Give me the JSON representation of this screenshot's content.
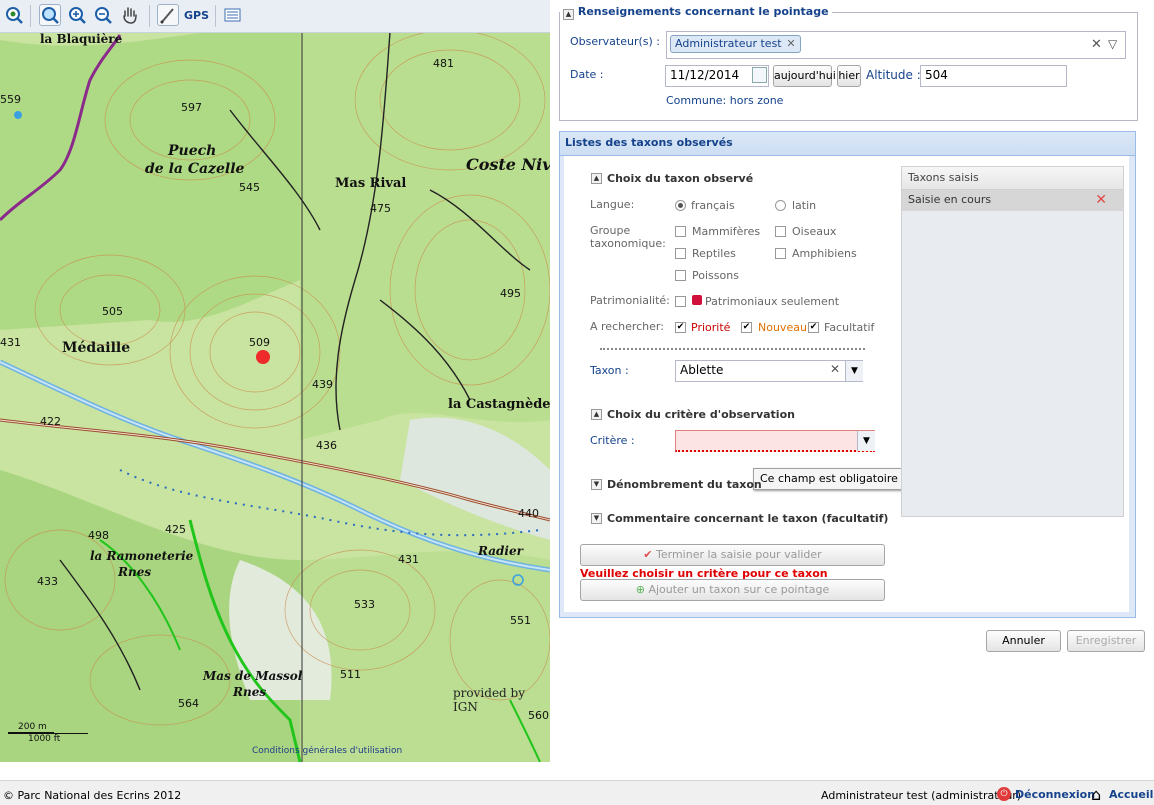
{
  "map": {
    "toolbar": {
      "gps_label": "GPS"
    },
    "labels": {
      "puech": "Puech",
      "cazelle": "de la Cazelle",
      "mas_rival": "Mas Rival",
      "coste": "Coste Niv",
      "medaille": "Médaille",
      "castagnede": "la Castagnède",
      "ramoneterie": "la Ramoneterie",
      "rnes1": "Rnes",
      "massol": "Mas de Massol",
      "rnes2": "Rnes",
      "radier": "Radier",
      "blaquiere": "la Blaquière"
    },
    "elevations": [
      "597",
      "545",
      "475",
      "481",
      "495",
      "505",
      "509",
      "439",
      "436",
      "422",
      "431",
      "498",
      "425",
      "433",
      "431",
      "533",
      "440",
      "511",
      "564",
      "551",
      "560",
      "559"
    ],
    "scale": {
      "meters": "200 m",
      "feet": "1000 ft"
    },
    "credit": "provided by IGN",
    "conditions": "Conditions générales d'utilisation"
  },
  "pointage": {
    "legend": "Renseignements concernant le pointage",
    "observers_label": "Observateur(s) :",
    "observer_tag": "Administrateur test",
    "date_label": "Date :",
    "date_value": "11/12/2014",
    "today_button": "aujourd'hui",
    "yesterday_button": "hier",
    "altitude_label": "Altitude :",
    "altitude_value": "504",
    "commune": "Commune: hors zone"
  },
  "taxons": {
    "header": "Listes des taxons observés",
    "choice_title": "Choix du taxon observé",
    "langue_label": "Langue:",
    "langue_options": [
      "français",
      "latin"
    ],
    "groupe_label_1": "Groupe",
    "groupe_label_2": "taxonomique:",
    "groupes": [
      "Mammifères",
      "Oiseaux",
      "Reptiles",
      "Amphibiens",
      "Poissons"
    ],
    "patrimonialite_label": "Patrimonialité:",
    "patrimoniaux": "Patrimoniaux seulement",
    "rechercher_label": "A rechercher:",
    "priorite": "Priorité",
    "nouveau": "Nouveau",
    "facultatif": "Facultatif",
    "taxon_label": "Taxon :",
    "taxon_value": "Ablette",
    "critere_title": "Choix du critère d'observation",
    "critere_label": "Critère :",
    "tooltip": "Ce champ est obligatoire",
    "denombrement_title": "Dénombrement du taxon",
    "commentaire_title": "Commentaire concernant le taxon (facultatif)",
    "terminer_button": "Terminer la saisie pour valider",
    "error_message": "Veuillez choisir un critère pour ce taxon",
    "ajouter_button": "Ajouter un taxon sur ce pointage",
    "grid_header": "Taxons saisis",
    "grid_row": "Saisie en cours",
    "colors": {
      "error": "#e00000",
      "nouveau": "#e07000",
      "priorite": "#cc0000"
    }
  },
  "actions": {
    "annuler": "Annuler",
    "enregistrer": "Enregistrer"
  },
  "footer": {
    "copyright": "© Parc National des Ecrins 2012",
    "user": "Administrateur test (administrateur)",
    "logout": "Déconnexion",
    "home": "Accueil"
  }
}
